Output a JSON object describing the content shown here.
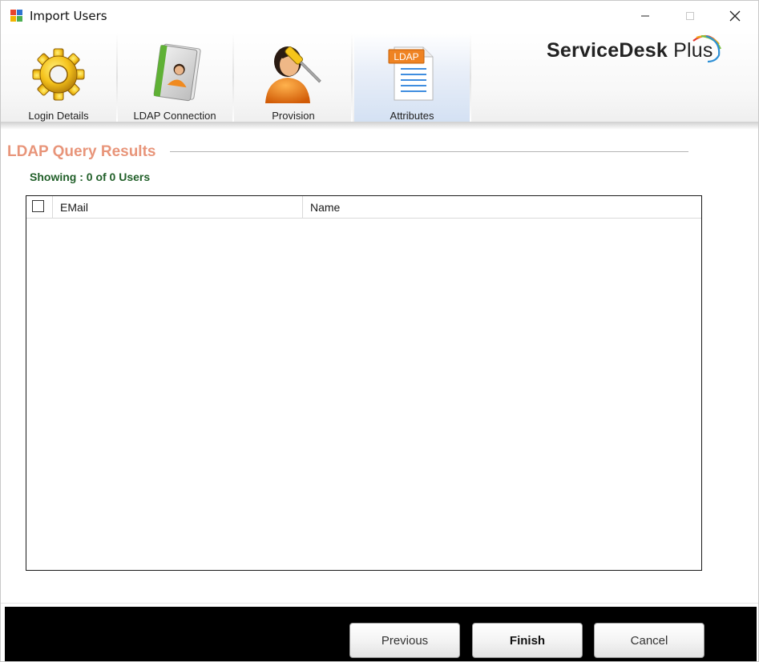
{
  "window": {
    "title": "Import Users"
  },
  "steps": [
    {
      "label": "Login Details",
      "icon": "gear-icon"
    },
    {
      "label": "LDAP Connection",
      "icon": "address-book-icon"
    },
    {
      "label": "Provision",
      "icon": "user-screwdriver-icon"
    },
    {
      "label": "Attributes",
      "icon": "ldap-document-icon",
      "badge": "LDAP",
      "active": true
    }
  ],
  "logo": {
    "brand_strong": "ServiceDesk",
    "brand_light": " Plus"
  },
  "results": {
    "title": "LDAP Query Results",
    "showing": "Showing : 0 of 0 Users",
    "columns": [
      "EMail",
      "Name"
    ],
    "rows": []
  },
  "buttons": {
    "previous": "Previous",
    "finish": "Finish",
    "cancel": "Cancel"
  },
  "colors": {
    "section_title": "#e8957a",
    "showing_text": "#22602a",
    "active_step": "#d4e1f3"
  }
}
